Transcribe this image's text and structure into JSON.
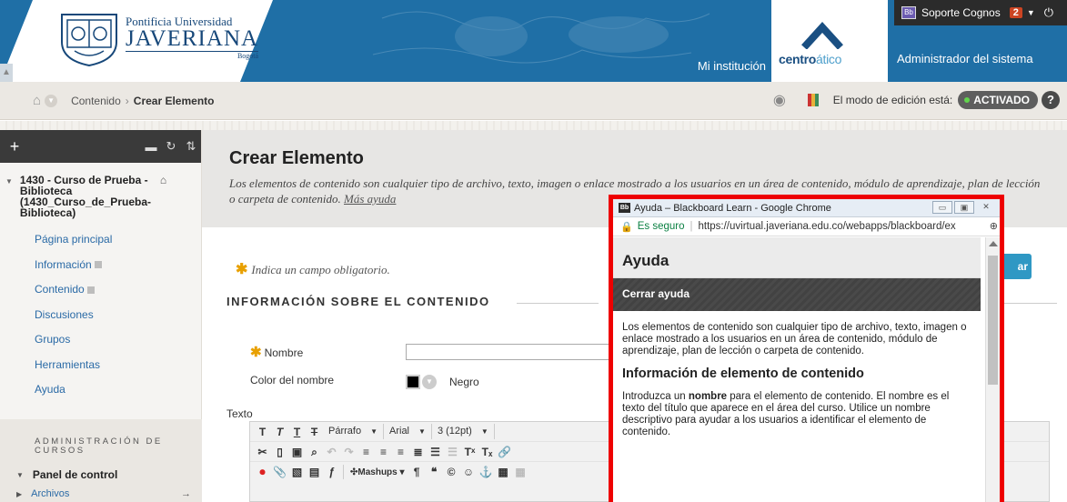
{
  "banner": {
    "logo_line1": "Pontificia Universidad",
    "logo_line2": "JAVERIANA",
    "logo_line3": "Bogotá",
    "tab_institution": "Mi institución",
    "centro_bold": "centro",
    "centro_light": "ático",
    "tab_admin": "Administrador del sistema",
    "user_name": "Soporte Cognos",
    "notification_count": "2",
    "brand_blue": "#1f6fa6"
  },
  "breadcrumb": {
    "items": [
      "Contenido",
      "Crear Elemento"
    ],
    "separator": "›",
    "edit_mode_label": "El modo de edición está:",
    "edit_mode_value": "ACTIVADO",
    "help_label": "?"
  },
  "sidebar": {
    "course_title": "1430 - Curso de Prueba - Biblioteca (1430_Curso_de_Prueba-Biblioteca)",
    "menu": [
      {
        "label": "Página principal",
        "has_marker": false
      },
      {
        "label": "Información",
        "has_marker": true
      },
      {
        "label": "Contenido",
        "has_marker": true
      },
      {
        "label": "Discusiones",
        "has_marker": false
      },
      {
        "label": "Grupos",
        "has_marker": false
      },
      {
        "label": "Herramientas",
        "has_marker": false
      },
      {
        "label": "Ayuda",
        "has_marker": false
      }
    ],
    "admin_title": "ADMINISTRACIÓN DE CURSOS",
    "panel_label": "Panel de control",
    "files_label": "Archivos"
  },
  "main": {
    "title": "Crear Elemento",
    "description": "Los elementos de contenido son cualquier tipo de archivo, texto, imagen o enlace mostrado a los usuarios en un área de contenido, módulo de aprendizaje, plan de lección o carpeta de contenido.",
    "more_help": "Más ayuda",
    "required_note": "Indica un campo obligatorio.",
    "section_title": "INFORMACIÓN SOBRE EL CONTENIDO",
    "submit_partial": "ar",
    "name_label": "Nombre",
    "name_value": "",
    "color_label": "Color del nombre",
    "color_value": "Negro",
    "text_label": "Texto",
    "editor": {
      "paragraph": "Párrafo",
      "font": "Arial",
      "size": "3 (12pt)",
      "mashups": "Mashups"
    }
  },
  "help_popup": {
    "window_title": "Ayuda – Blackboard Learn - Google Chrome",
    "secure_label": "Es seguro",
    "url": "https://uvirtual.javeriana.edu.co/webapps/blackboard/ex",
    "heading": "Ayuda",
    "close_label": "Cerrar ayuda",
    "para1": "Los elementos de contenido son cualquier tipo de archivo, texto, imagen o enlace mostrado a los usuarios en un área de contenido, módulo de aprendizaje, plan de lección o carpeta de contenido.",
    "subheading": "Información de elemento de contenido",
    "para2_pre": "Introduzca un ",
    "para2_bold": "nombre",
    "para2_post": " para el elemento de contenido. El nombre es el texto del título que aparece en el área del curso. Utilice un nombre descriptivo para ayudar a los usuarios a identificar el elemento de contenido.",
    "highlight_color": "#ee0000"
  }
}
